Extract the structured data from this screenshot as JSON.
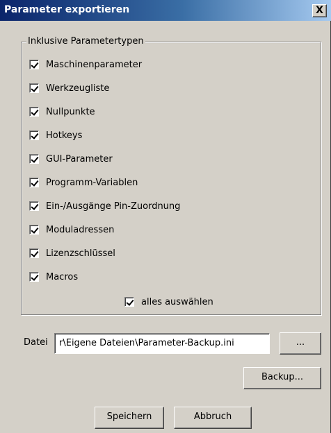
{
  "window": {
    "title": "Parameter exportieren",
    "close_label": "X"
  },
  "group": {
    "legend": "Inklusive Parametertypen",
    "items": [
      {
        "label": "Maschinenparameter",
        "checked": true
      },
      {
        "label": "Werkzeugliste",
        "checked": true
      },
      {
        "label": "Nullpunkte",
        "checked": true
      },
      {
        "label": "Hotkeys",
        "checked": true
      },
      {
        "label": "GUI-Parameter",
        "checked": true
      },
      {
        "label": "Programm-Variablen",
        "checked": true
      },
      {
        "label": "Ein-/Ausgänge Pin-Zuordnung",
        "checked": true
      },
      {
        "label": "Moduladressen",
        "checked": true
      },
      {
        "label": "Lizenzschlüssel",
        "checked": true
      },
      {
        "label": "Macros",
        "checked": true
      }
    ],
    "select_all": {
      "label": "alles auswählen",
      "checked": true
    }
  },
  "file": {
    "label": "Datei",
    "value": "r\\Eigene Dateien\\Parameter-Backup.ini",
    "browse_label": "..."
  },
  "buttons": {
    "backup": "Backup...",
    "save": "Speichern",
    "cancel": "Abbruch"
  }
}
